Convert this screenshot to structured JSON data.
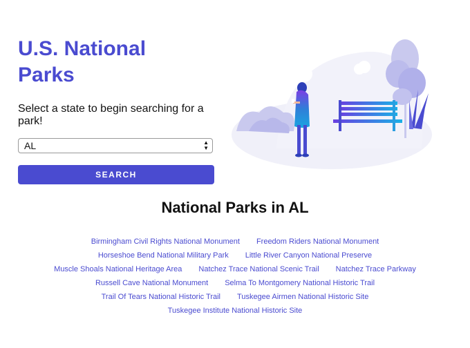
{
  "header": {
    "title": "U.S. National Parks"
  },
  "search": {
    "prompt": "Select a state to begin searching for a park!",
    "selected_state": "AL",
    "button_label": "SEARCH"
  },
  "illustration": {
    "icon": "person-with-park-bench-illustration"
  },
  "results": {
    "heading": "National Parks in AL",
    "parks": [
      "Birmingham Civil Rights National Monument",
      "Freedom Riders National Monument",
      "Horseshoe Bend National Military Park",
      "Little River Canyon National Preserve",
      "Muscle Shoals National Heritage Area",
      "Natchez Trace National Scenic Trail",
      "Natchez Trace Parkway",
      "Russell Cave National Monument",
      "Selma To Montgomery National Historic Trail",
      "Trail Of Tears National Historic Trail",
      "Tuskegee Airmen National Historic Site",
      "Tuskegee Institute National Historic Site"
    ]
  },
  "colors": {
    "accent": "#4a4bd0",
    "text": "#111111",
    "illustration_light": "#e9e9f7"
  }
}
